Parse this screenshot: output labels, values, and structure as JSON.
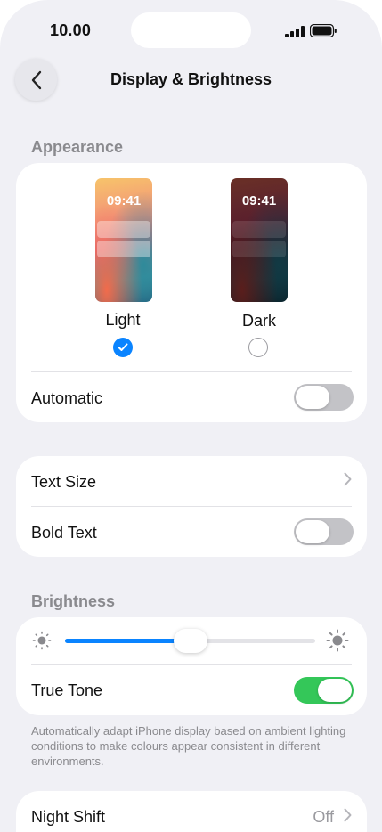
{
  "status_bar": {
    "time": "10.00",
    "signal_icon": "cellular-signal-icon",
    "battery_icon": "battery-icon"
  },
  "nav": {
    "back_icon": "chevron-left-icon",
    "title": "Display & Brightness"
  },
  "appearance": {
    "header": "Appearance",
    "options": [
      {
        "label": "Light",
        "preview_time": "09:41",
        "selected": true
      },
      {
        "label": "Dark",
        "preview_time": "09:41",
        "selected": false
      }
    ],
    "automatic": {
      "label": "Automatic",
      "on": false
    }
  },
  "text_section": {
    "text_size": {
      "label": "Text Size"
    },
    "bold_text": {
      "label": "Bold Text",
      "on": false
    }
  },
  "brightness": {
    "header": "Brightness",
    "level": 0.5,
    "min_icon": "sun-dim-icon",
    "max_icon": "sun-bright-icon",
    "true_tone": {
      "label": "True Tone",
      "on": true
    },
    "footnote": "Automatically adapt iPhone display based on ambient lighting conditions to make colours appear consistent in different environments."
  },
  "night_shift": {
    "label": "Night Shift",
    "value": "Off"
  },
  "colors": {
    "accent": "#0a84ff",
    "toggle_on": "#34c759",
    "toggle_off": "#c3c3c7",
    "background": "#f0f0f5"
  }
}
